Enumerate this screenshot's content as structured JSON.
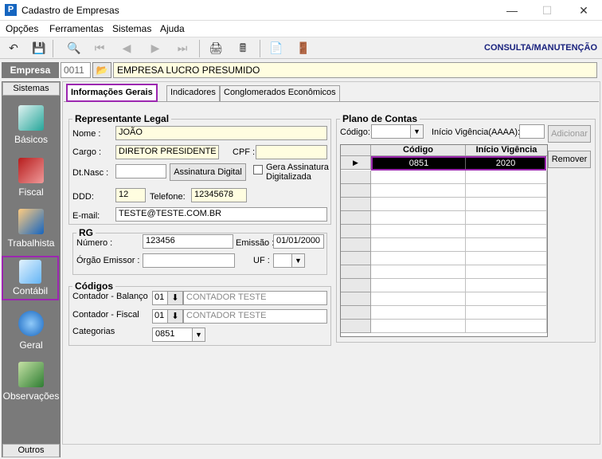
{
  "window": {
    "title": "Cadastro de Empresas",
    "app_icon": "P"
  },
  "menu": [
    "Opções",
    "Ferramentas",
    "Sistemas",
    "Ajuda"
  ],
  "toolbar": {
    "mode": "CONSULTA/MANUTENÇÃO"
  },
  "empresa": {
    "label": "Empresa",
    "code": "0011",
    "name": "EMPRESA LUCRO PRESUMIDO"
  },
  "sidebar": {
    "header": "Sistemas",
    "footer": "Outros",
    "items": [
      {
        "label": "Básicos",
        "icon": "basicos-icon"
      },
      {
        "label": "Fiscal",
        "icon": "fiscal-icon"
      },
      {
        "label": "Trabalhista",
        "icon": "trabalhista-icon"
      },
      {
        "label": "Contábil",
        "icon": "contabil-icon",
        "selected": true
      },
      {
        "label": "Geral",
        "icon": "geral-icon"
      },
      {
        "label": "Observações",
        "icon": "observacoes-icon"
      }
    ]
  },
  "tabs": [
    "Informações Gerais",
    "Indicadores",
    "Conglomerados Econômicos"
  ],
  "representante": {
    "legend": "Representante Legal",
    "nome_label": "Nome :",
    "nome": "JOÃO",
    "cargo_label": "Cargo :",
    "cargo": "DIRETOR PRESIDENTE",
    "cpf_label": "CPF :",
    "cpf": "",
    "dtnasc_label": "Dt.Nasc :",
    "dtnasc": "",
    "assinatura_btn": "Assinatura Digital",
    "gera_assinatura": "Gera Assinatura Digitalizada",
    "ddd_label": "DDD:",
    "ddd": "12",
    "telefone_label": "Telefone:",
    "telefone": "12345678",
    "email_label": "E-mail:",
    "email": "TESTE@TESTE.COM.BR"
  },
  "rg": {
    "legend": "RG",
    "numero_label": "Número :",
    "numero": "123456",
    "emissao_label": "Emissão :",
    "emissao": "01/01/2000",
    "orgao_label": "Órgão Emissor :",
    "orgao": "",
    "uf_label": "UF :",
    "uf": ""
  },
  "codigos": {
    "legend": "Códigos",
    "balanco_label": "Contador - Balanço",
    "balanco_code": "01",
    "balanco_name": "CONTADOR TESTE",
    "fiscal_label": "Contador - Fiscal",
    "fiscal_code": "01",
    "fiscal_name": "CONTADOR TESTE",
    "categorias_label": "Categorias",
    "categorias": "0851"
  },
  "plano": {
    "legend": "Plano de Contas",
    "codigo_label": "Código:",
    "codigo": "",
    "vigencia_label": "Início Vigência(AAAA):",
    "vigencia": "",
    "adicionar": "Adicionar",
    "remover": "Remover",
    "columns": [
      "Código",
      "Início Vigência"
    ],
    "rows": [
      [
        "0851",
        "2020"
      ]
    ]
  },
  "colors": {
    "highlight": "#9c27b0",
    "mode_text": "#1a237e",
    "yellow_field": "#fffde0"
  }
}
